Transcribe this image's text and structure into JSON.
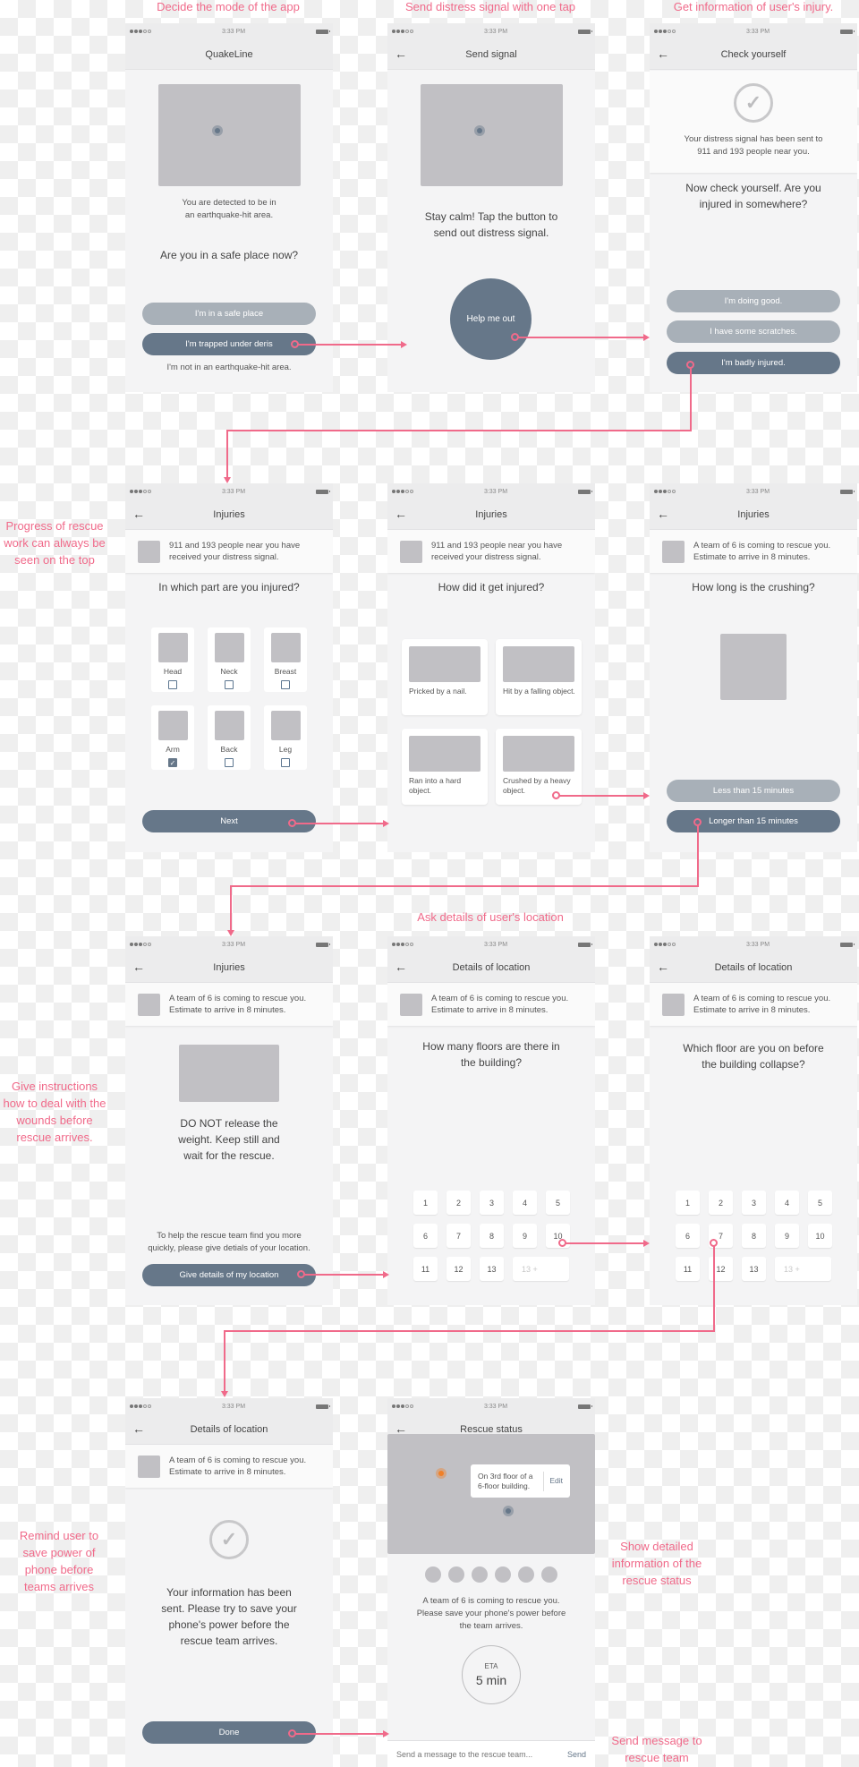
{
  "annotations": {
    "a1": "Decide the mode of the app",
    "a2": "Send distress signal with one tap",
    "a3": "Get information of user's injury.",
    "progress": "Progress of rescue work can always be seen on the top",
    "location": "Ask details of user's location",
    "instructions": "Give instructions how to deal with the wounds before rescue arrives.",
    "remind": "Remind user to save power of phone before teams arrives",
    "status": "Show detailed information of the rescue status",
    "message": "Send message to rescue team"
  },
  "status_time": "3:33 PM",
  "banner": {
    "received": "911 and 193 people near you have received your distress signal.",
    "team": "A team of 6 is coming to rescue you. Estimate to arrive in 8 minutes."
  },
  "screens": {
    "s1": {
      "title": "QuakeLine",
      "detected": "You are detected to be in an earthquake-hit area.",
      "question": "Are you in a safe place now?",
      "btn_safe": "I'm in a safe place",
      "btn_trapped": "I'm trapped under deris",
      "not_in_area": "I'm not in an earthquake-hit area."
    },
    "s2": {
      "title": "Send signal",
      "text": "Stay calm! Tap the button to send out distress signal.",
      "btn_help": "Help me out"
    },
    "s3": {
      "title": "Check yourself",
      "sent": "Your distress signal has been sent to 911 and 193 people near you.",
      "question": "Now check yourself. Are you injured in somewhere?",
      "btn_good": "I'm doing good.",
      "btn_scratches": "I have some scratches.",
      "btn_badly": "I'm badly injured."
    },
    "s4": {
      "title": "Injuries",
      "question": "In which part are you injured?",
      "parts": [
        {
          "label": "Head",
          "checked": false
        },
        {
          "label": "Neck",
          "checked": false
        },
        {
          "label": "Breast",
          "checked": false
        },
        {
          "label": "Arm",
          "checked": true
        },
        {
          "label": "Back",
          "checked": false
        },
        {
          "label": "Leg",
          "checked": false
        }
      ],
      "btn_next": "Next"
    },
    "s5": {
      "title": "Injuries",
      "question": "How did it get injured?",
      "causes": [
        "Pricked by a nail.",
        "Hit by a falling object.",
        "Ran into a hard object.",
        "Crushed by a heavy object."
      ]
    },
    "s6": {
      "title": "Injuries",
      "question": "How long is the crushing?",
      "btn_less": "Less than 15 minutes",
      "btn_longer": "Longer than 15 minutes"
    },
    "s7": {
      "title": "Injuries",
      "instruction": "DO NOT release the weight. Keep still and wait for the rescue.",
      "help_text": "To help the rescue team find you more quickly, please give detials of your location.",
      "btn_location": "Give details of my location"
    },
    "s8": {
      "title": "Details of location",
      "question": "How many floors are there in the building?"
    },
    "s9": {
      "title": "Details of location",
      "question": "Which floor are you on before the building collapse?"
    },
    "floors": [
      "1",
      "2",
      "3",
      "4",
      "5",
      "6",
      "7",
      "8",
      "9",
      "10",
      "11",
      "12",
      "13",
      "13 +"
    ],
    "s10": {
      "title": "Details of location",
      "text": "Your information has been sent. Please try to save your phone's power before the rescue team arrives.",
      "btn_done": "Done"
    },
    "s11": {
      "title": "Rescue status",
      "tooltip": "On 3rd floor of a 6-floor building.",
      "edit": "Edit",
      "team_count": 6,
      "info": "A team of 6 is coming to rescue you. Please save your phone's power before the team arrives.",
      "eta_label": "ETA",
      "eta_value": "5 min",
      "message_placeholder": "Send a message to the rescue team...",
      "send": "Send"
    }
  }
}
